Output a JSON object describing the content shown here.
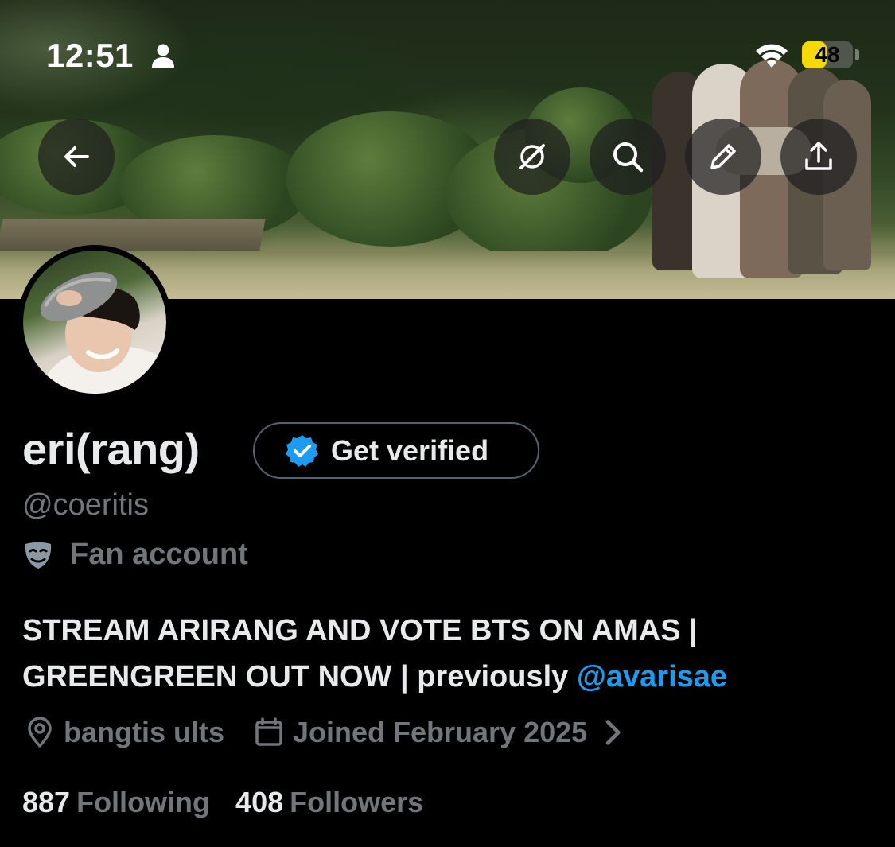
{
  "status_bar": {
    "time": "12:51",
    "battery_level": 48,
    "battery_label": "48",
    "icons": [
      "person-icon",
      "wifi-icon",
      "battery-icon"
    ]
  },
  "header_actions": {
    "back": "arrow-left-icon",
    "grok": "grok-icon",
    "search": "search-icon",
    "edit": "pencil-icon",
    "share": "share-icon"
  },
  "profile": {
    "display_name": "eri(rang)",
    "verify_label": "Get verified",
    "handle": "@coeritis",
    "category": "Fan account",
    "bio_text": "STREAM ARIRANG AND VOTE BTS ON AMAS | GREENGREEN OUT NOW | previously ",
    "bio_mention": "@avarisae",
    "location": "bangtis ults",
    "joined": "Joined February 2025",
    "following_count": "887",
    "following_label": "Following",
    "followers_count": "408",
    "followers_label": "Followers"
  },
  "colors": {
    "background": "#000000",
    "text_primary": "#e7e9ea",
    "text_secondary": "#71767b",
    "accent_blue": "#1d9bf0",
    "battery_yellow": "#f5d90a"
  }
}
